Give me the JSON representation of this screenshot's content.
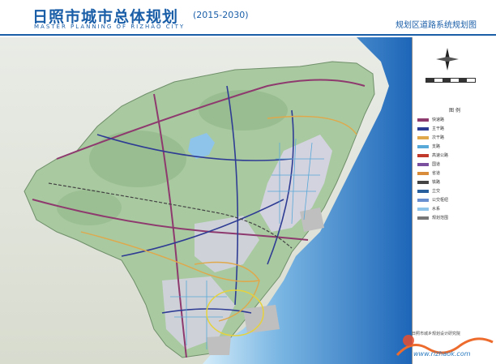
{
  "header": {
    "title": "日照市城市总体规划",
    "years": "(2015-2030)",
    "english_title": "MASTER PLANNING OF RIZHAO CITY",
    "map_title": "规划区道路系统规划图"
  },
  "map": {
    "colors": {
      "land": "#a9c9a0",
      "sea": "#1d76c9",
      "sea_light": "#8fc4ea",
      "expressway": "#8e3a6f",
      "trunk_road": "#2f3c94",
      "main_road": "#e0a84a",
      "secondary_road": "#58a8d8",
      "rail": "#444444"
    }
  },
  "legend": {
    "title": "图 例",
    "items": [
      {
        "label": "快速路",
        "color": "#8e3a6f"
      },
      {
        "label": "主干路",
        "color": "#2f3c94"
      },
      {
        "label": "次干路",
        "color": "#e0a84a"
      },
      {
        "label": "支路",
        "color": "#58a8d8"
      },
      {
        "label": "高速公路",
        "color": "#c0392b"
      },
      {
        "label": "国道",
        "color": "#7a4f9e"
      },
      {
        "label": "省道",
        "color": "#d98c3a"
      },
      {
        "label": "铁路",
        "color": "#444444"
      },
      {
        "label": "立交",
        "color": "#2a5f9e"
      },
      {
        "label": "公交枢纽",
        "color": "#6a8fd0"
      },
      {
        "label": "水系",
        "color": "#8fc4ea"
      },
      {
        "label": "规划范围",
        "color": "#777777"
      }
    ],
    "note": "日照市城乡规划设计研究院"
  },
  "watermark": {
    "text": "www.rizhaok.com"
  }
}
